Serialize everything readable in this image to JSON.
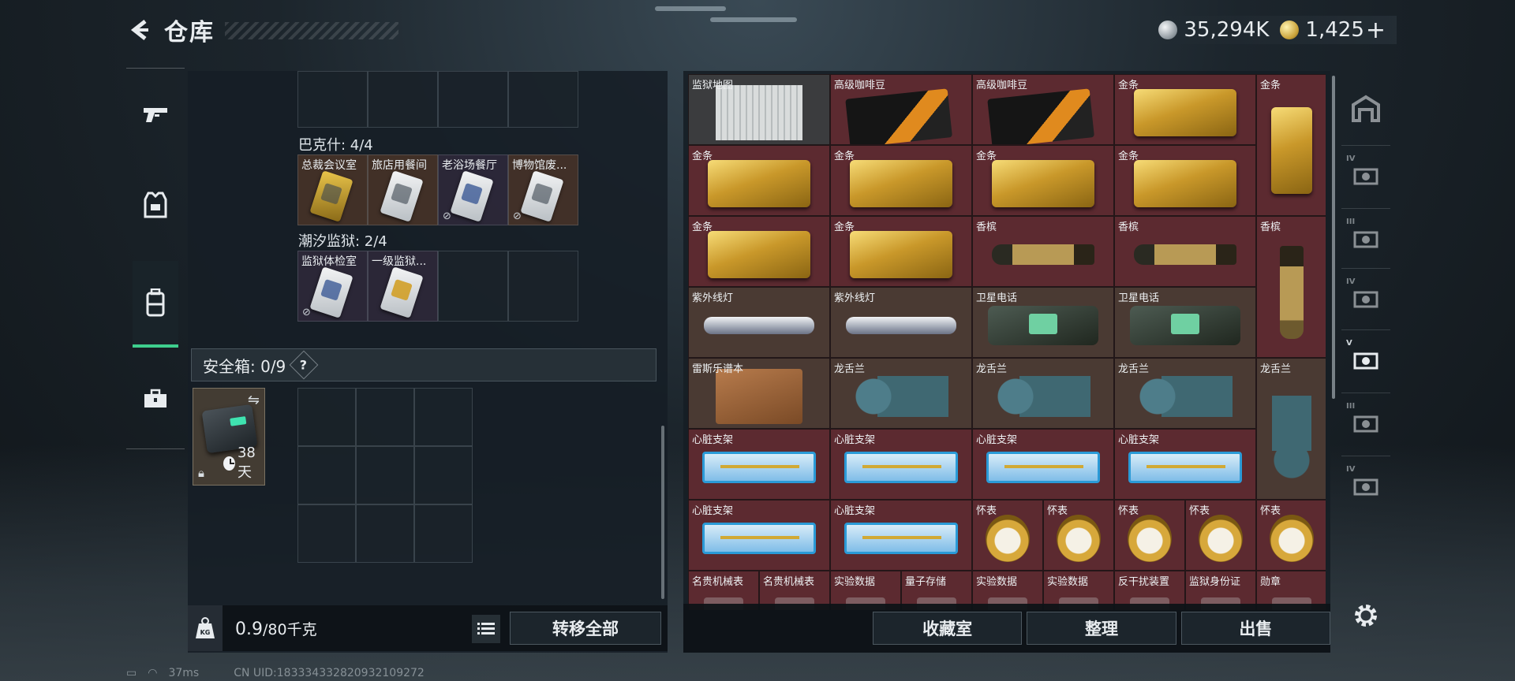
{
  "header": {
    "title": "仓库",
    "currency_silver": "35,294K",
    "currency_gold": "1,425",
    "currency_plus": "+"
  },
  "left_rail": [
    {
      "name": "weapon-filter",
      "icon": "pistol-icon"
    },
    {
      "name": "armor-filter",
      "icon": "vest-icon"
    },
    {
      "name": "backpack-filter",
      "icon": "backpack-icon",
      "active": true
    },
    {
      "name": "case-filter",
      "icon": "briefcase-icon"
    }
  ],
  "sections": {
    "bakshi": {
      "label": "巴克什: 4/4",
      "cards": [
        {
          "name": "总裁会议室",
          "style": "yellow",
          "locked": false
        },
        {
          "name": "旅店用餐间",
          "style": "white",
          "locked": false
        },
        {
          "name": "老浴场餐厅",
          "style": "blue",
          "locked": true
        },
        {
          "name": "博物馆废...",
          "style": "white",
          "locked": true
        }
      ]
    },
    "prison": {
      "label": "潮汐监狱: 2/4",
      "cards": [
        {
          "name": "监狱体检室",
          "style": "blue",
          "locked": true
        },
        {
          "name": "一级监狱...",
          "style": "amber",
          "locked": false
        }
      ]
    },
    "safe": {
      "label": "安全箱: 0/9",
      "help": "?",
      "timer": "38天"
    }
  },
  "left_footer": {
    "weight_current": "0.9",
    "weight_suffix": "/80千克",
    "weight_icon_label": "KG",
    "transfer_all": "转移全部"
  },
  "warehouse": {
    "items": [
      {
        "name": "监狱地图",
        "bg": "gry",
        "art": "map"
      },
      {
        "name": "高级咖啡豆",
        "bg": "red",
        "art": "coffee"
      },
      {
        "name": "高级咖啡豆",
        "bg": "red",
        "art": "coffee"
      },
      {
        "name": "金条",
        "bg": "red",
        "art": "gold-bar"
      },
      {
        "name": "金条",
        "bg": "red",
        "art": "gold-bar v"
      },
      {
        "name": "金条",
        "bg": "red",
        "art": "gold-bar"
      },
      {
        "name": "金条",
        "bg": "red",
        "art": "gold-bar"
      },
      {
        "name": "金条",
        "bg": "red",
        "art": "gold-bar"
      },
      {
        "name": "金条",
        "bg": "red",
        "art": "gold-bar"
      },
      {
        "name": "金条",
        "bg": "red",
        "art": "gold-bar"
      },
      {
        "name": "金条",
        "bg": "red",
        "art": "gold-bar"
      },
      {
        "name": "香槟",
        "bg": "red",
        "art": "champ"
      },
      {
        "name": "香槟",
        "bg": "red",
        "art": "champ"
      },
      {
        "name": "香槟",
        "bg": "red",
        "art": "champ v"
      },
      {
        "name": "紫外线灯",
        "bg": "brn",
        "art": "uvlamp"
      },
      {
        "name": "紫外线灯",
        "bg": "brn",
        "art": "uvlamp"
      },
      {
        "name": "卫星电话",
        "bg": "brn",
        "art": "sat-phone"
      },
      {
        "name": "卫星电话",
        "bg": "brn",
        "art": "sat-phone"
      },
      {
        "name": "雷斯乐谱本",
        "bg": "brn",
        "art": "notebook"
      },
      {
        "name": "龙舌兰",
        "bg": "brn",
        "art": "dragon"
      },
      {
        "name": "龙舌兰",
        "bg": "brn",
        "art": "dragon"
      },
      {
        "name": "龙舌兰",
        "bg": "brn",
        "art": "dragon"
      },
      {
        "name": "龙舌兰",
        "bg": "brn",
        "art": "dragon v"
      },
      {
        "name": "心脏支架",
        "bg": "red",
        "art": "stent"
      },
      {
        "name": "心脏支架",
        "bg": "red",
        "art": "stent"
      },
      {
        "name": "心脏支架",
        "bg": "red",
        "art": "stent"
      },
      {
        "name": "心脏支架",
        "bg": "red",
        "art": "stent"
      },
      {
        "name": "心脏支架",
        "bg": "red",
        "art": "stent"
      },
      {
        "name": "心脏支架",
        "bg": "red",
        "art": "stent"
      },
      {
        "name": "怀表",
        "bg": "red",
        "art": "watch"
      },
      {
        "name": "怀表",
        "bg": "red",
        "art": "watch"
      },
      {
        "name": "怀表",
        "bg": "red",
        "art": "watch"
      },
      {
        "name": "怀表",
        "bg": "red",
        "art": "watch"
      },
      {
        "name": "怀表",
        "bg": "red",
        "art": "watch"
      },
      {
        "name": "名贵机械表",
        "bg": "red",
        "art": "mini"
      },
      {
        "name": "名贵机械表",
        "bg": "red",
        "art": "mini"
      },
      {
        "name": "实验数据",
        "bg": "red",
        "art": "mini"
      },
      {
        "name": "量子存储",
        "bg": "red",
        "art": "mini"
      },
      {
        "name": "实验数据",
        "bg": "red",
        "art": "mini"
      },
      {
        "name": "实验数据",
        "bg": "red",
        "art": "mini"
      },
      {
        "name": "反干扰装置",
        "bg": "red",
        "art": "mini"
      },
      {
        "name": "监狱身份证",
        "bg": "red",
        "art": "mini"
      },
      {
        "name": "勋章",
        "bg": "red",
        "art": "mini"
      }
    ]
  },
  "right_footer": {
    "collection": "收藏室",
    "organize": "整理",
    "sell": "出售"
  },
  "right_rail": [
    {
      "name": "filter-all",
      "tier": ""
    },
    {
      "name": "filter-tier4-a",
      "tier": "IV"
    },
    {
      "name": "filter-tier3-a",
      "tier": "III"
    },
    {
      "name": "filter-tier4-b",
      "tier": "IV"
    },
    {
      "name": "filter-tier5",
      "tier": "V",
      "active": true
    },
    {
      "name": "filter-tier3-b",
      "tier": "III"
    },
    {
      "name": "filter-tier4-c",
      "tier": "IV"
    }
  ],
  "status_bar": {
    "ping": "37ms",
    "uid": "CN UID:18333433282093210927​2"
  },
  "colors": {
    "accent_green": "#3ecf8e",
    "item_red": "#5c2a30",
    "item_brown": "#4a3a33"
  }
}
